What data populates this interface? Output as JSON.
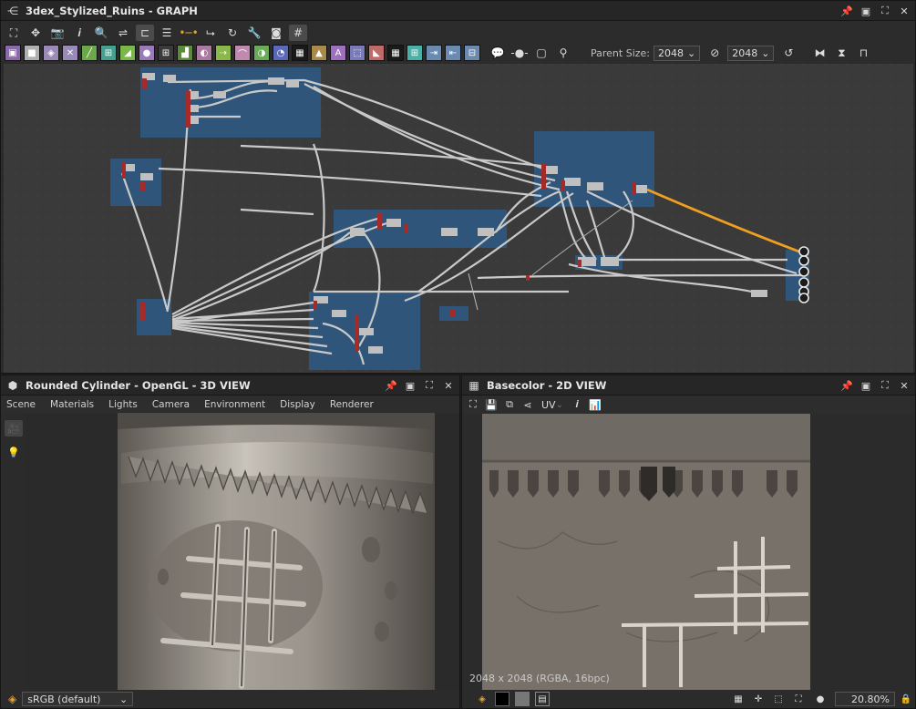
{
  "graph_panel": {
    "title": "3dex_Stylized_Ruins - GRAPH",
    "parent_size_label": "Parent Size:",
    "parent_size_value": "2048",
    "size_value": "2048",
    "atoms": [
      {
        "name": "bitmap-atom-icon",
        "color": "#8a6aa8",
        "glyph": "▣"
      },
      {
        "name": "uniform-atom-icon",
        "color": "#b0b0b0",
        "glyph": "■"
      },
      {
        "name": "blur-atom-icon",
        "color": "#9a8ab8",
        "glyph": "◈"
      },
      {
        "name": "shuffle-atom-icon",
        "color": "#9a8ab8",
        "glyph": "✕"
      },
      {
        "name": "curve-atom-icon",
        "color": "#6aa84a",
        "glyph": "╱"
      },
      {
        "name": "warp-atom-icon",
        "color": "#46a090",
        "glyph": "⊞"
      },
      {
        "name": "gradient-atom-icon",
        "color": "#7ab84a",
        "glyph": "◢"
      },
      {
        "name": "sphere-atom-icon",
        "color": "#9a7ab8",
        "glyph": "●"
      },
      {
        "name": "tile-atom-icon",
        "color": "#3a3a3a",
        "glyph": "⊞"
      },
      {
        "name": "levels-atom-icon",
        "color": "#5a8a3a",
        "glyph": "▟"
      },
      {
        "name": "hsl-atom-icon",
        "color": "#aa7aa0",
        "glyph": "◐"
      },
      {
        "name": "normal-atom-icon",
        "color": "#8ab84a",
        "glyph": "⇢"
      },
      {
        "name": "emboss-atom-icon",
        "color": "#c08ab0",
        "glyph": "⌒"
      },
      {
        "name": "grayscale-atom-icon",
        "color": "#6aaa5a",
        "glyph": "◑"
      },
      {
        "name": "ao-atom-icon",
        "color": "#5a6ab8",
        "glyph": "◔"
      },
      {
        "name": "noise-atom-icon",
        "color": "#1a1a1a",
        "glyph": "▦"
      },
      {
        "name": "warning-atom-icon",
        "color": "#aa8a4a",
        "glyph": "▲"
      },
      {
        "name": "text-atom-icon",
        "color": "#a070c0",
        "glyph": "A"
      },
      {
        "name": "transform-atom-icon",
        "color": "#7a7ab8",
        "glyph": "⬚"
      },
      {
        "name": "fill-atom-icon",
        "color": "#c06a6a",
        "glyph": "◣"
      },
      {
        "name": "distance-atom-icon",
        "color": "#1a1a1a",
        "glyph": "▦"
      },
      {
        "name": "fx-atom-icon",
        "color": "#4ab0a8",
        "glyph": "⊞"
      },
      {
        "name": "input-atom-icon",
        "color": "#6a8ab0",
        "glyph": "⇥"
      },
      {
        "name": "output-atom-icon",
        "color": "#6a8ab0",
        "glyph": "⇤"
      },
      {
        "name": "pixel-atom-icon",
        "color": "#6a8ab0",
        "glyph": "⊟"
      }
    ]
  },
  "view3d_panel": {
    "title": "Rounded Cylinder - OpenGL - 3D VIEW",
    "menus": [
      "Scene",
      "Materials",
      "Lights",
      "Camera",
      "Environment",
      "Display",
      "Renderer"
    ],
    "colorspace": "sRGB (default)"
  },
  "view2d_panel": {
    "title": "Basecolor - 2D VIEW",
    "uv_label": "UV",
    "resolution": "2048 x 2048 (RGBA, 16bpc)",
    "zoom": "20.80%"
  }
}
